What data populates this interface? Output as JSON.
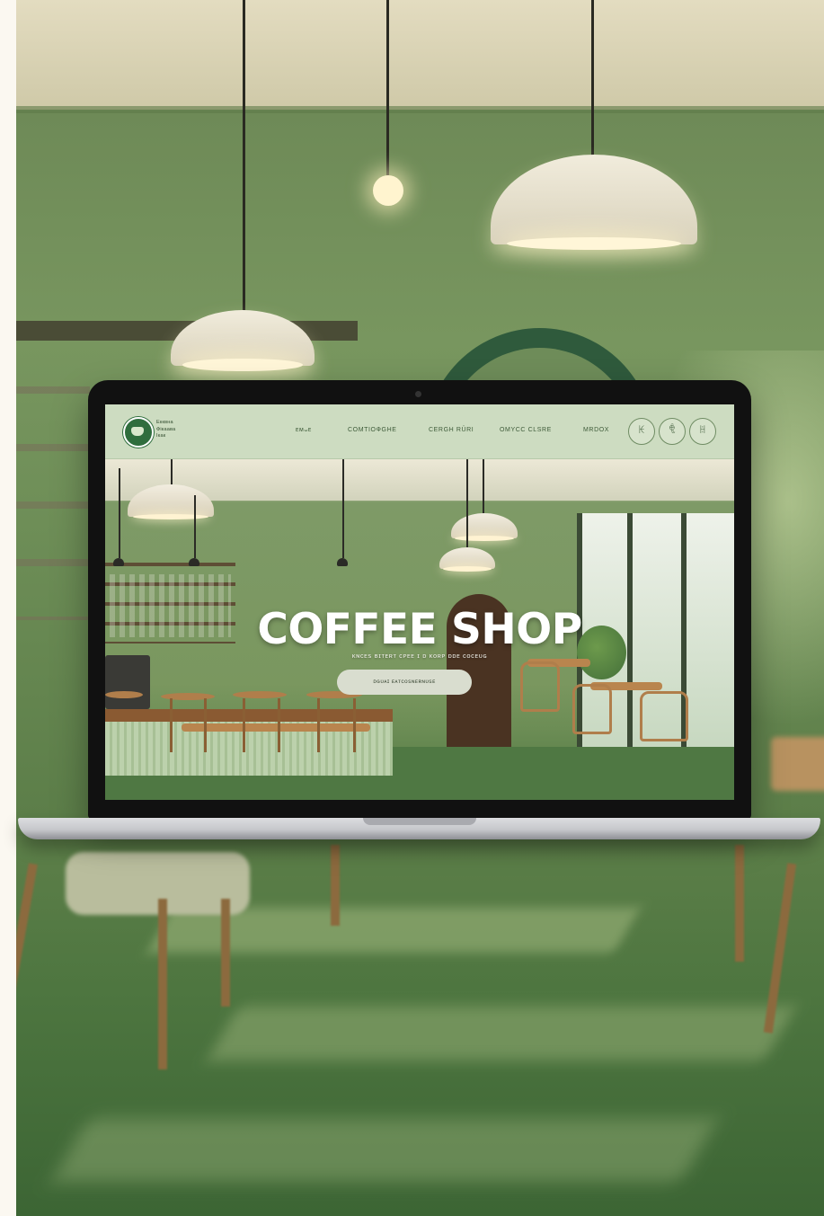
{
  "header": {
    "logo_icon": "coffee-cup-icon",
    "brand_lines": [
      "Екквна",
      "Фікаава",
      "Ікак"
    ],
    "nav": [
      "ᴇᴍ⁠ᴗᴇ",
      "COMTIOФGHE",
      "CERGH RÜRI",
      "OMYCC CLSRE",
      "MRDOX"
    ],
    "icons": [
      {
        "name": "search-icon",
        "glyph": "ꀘ"
      },
      {
        "name": "bag-icon",
        "glyph": "ꁷ"
      },
      {
        "name": "user-icon",
        "glyph": "ꀍ"
      }
    ]
  },
  "hero": {
    "title": "COFFEE SHOP",
    "subtitle": "ᴋɴᴄᴇꜱ ʙɪᴛᴇʀᴛ ᴄᴘᴇᴇ ɪ ᴅ ᴋᴏʀᴘ ᴅᴅᴇ ᴄᴏᴄᴇᴜɢ",
    "cta_label": "ᴅɢᴜᴀɪ ᴇᴀᴛᴄᴏꜱɴᴇʀɴᴜꜱᴇ"
  },
  "colors": {
    "header_bg": "#cddcc1",
    "accent_green": "#2f6d3d",
    "cta_bg": "#d9ddcf",
    "wall_green": "#78965f"
  }
}
